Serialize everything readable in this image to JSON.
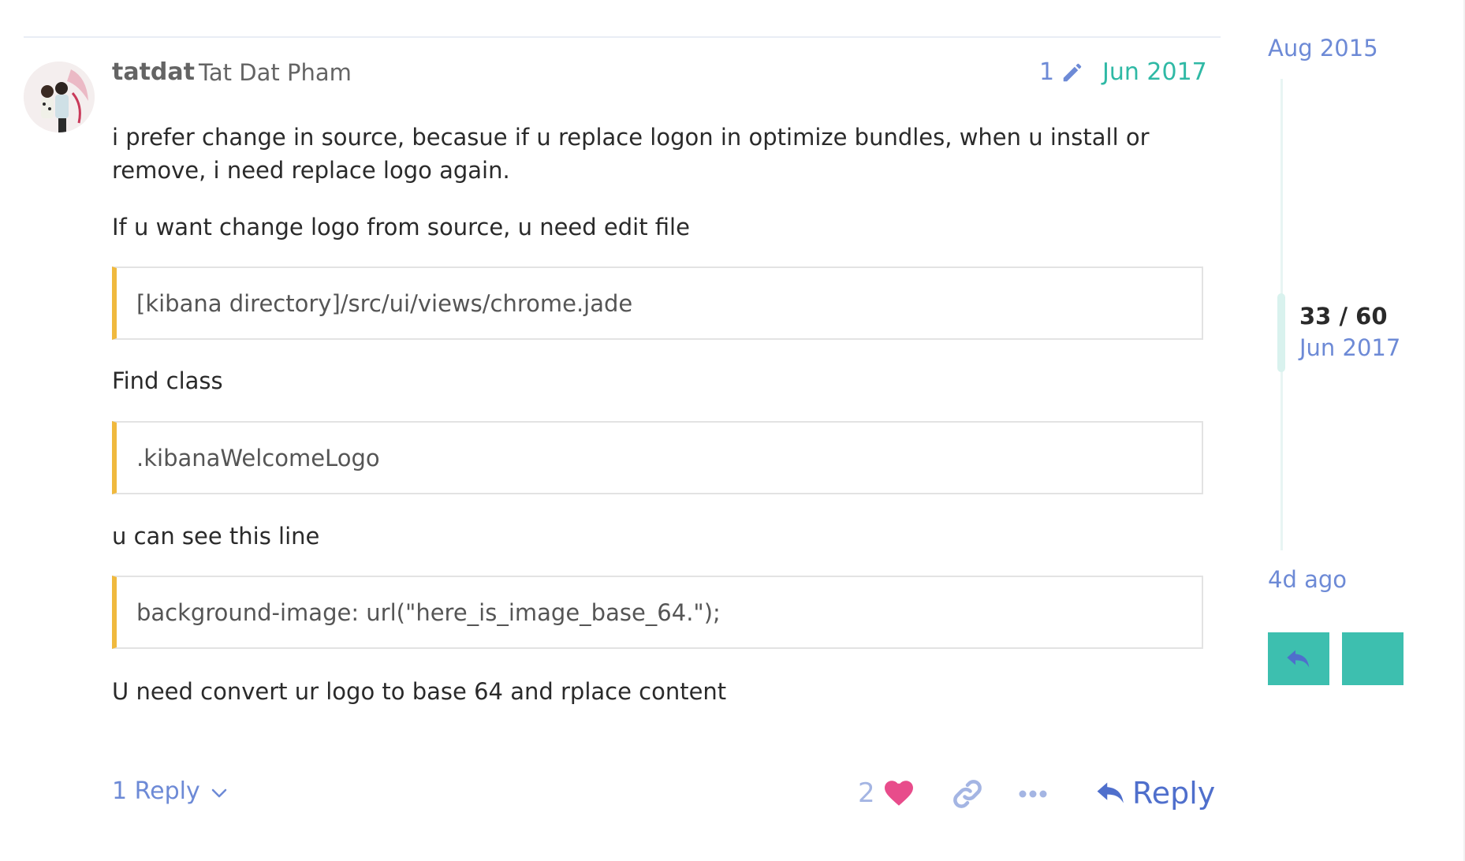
{
  "post": {
    "username": "tatdat",
    "full_name": "Tat Dat Pham",
    "edit_count": "1",
    "date": "Jun 2017",
    "paragraphs": [
      "i prefer change in source, becasue if u replace logon in optimize bundles, when u install or remove, i need replace logo again.",
      "If u want change logo from source, u need edit file",
      "Find class",
      "u can see this line",
      "U need convert ur logo to base 64 and rplace content"
    ],
    "quotes": [
      "[kibana directory]/src/ui/views/chrome.jade",
      ".kibanaWelcomeLogo",
      "background-image: url(\"here_is_image_base_64.\");"
    ]
  },
  "actions": {
    "replies_label": "1 Reply",
    "like_count": "2",
    "reply_label": "Reply"
  },
  "timeline": {
    "start": "Aug 2015",
    "position": "33 / 60",
    "current_date": "Jun 2017",
    "end": "4d ago"
  },
  "icons": {
    "edit": "pencil-icon",
    "chevron": "chevron-down-icon",
    "like": "heart-icon",
    "link": "link-icon",
    "more": "ellipsis-icon",
    "reply": "reply-arrow-icon"
  },
  "colors": {
    "accent_blue": "#6d8ad6",
    "accent_teal": "#2fb9a5",
    "quote_bar": "#f0b93e",
    "heart": "#e84c8b",
    "timeline_button": "#3dbfaf"
  }
}
